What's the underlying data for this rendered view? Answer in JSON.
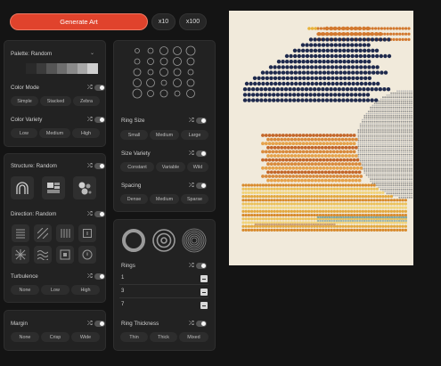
{
  "header": {
    "generate_label": "Generate Art",
    "x10_label": "x10",
    "x100_label": "x100"
  },
  "palette": {
    "label": "Palette:",
    "value": "Random",
    "swatches": [
      "#2a2a2a",
      "#3b3b3b",
      "#555555",
      "#6e6e6e",
      "#8a8a8a",
      "#a8a8a8",
      "#cfcfcf"
    ]
  },
  "color_mode": {
    "label": "Color Mode",
    "options": [
      "Simple",
      "Stacked",
      "Zebra"
    ]
  },
  "color_variety": {
    "label": "Color Variety",
    "options": [
      "Low",
      "Medium",
      "High"
    ]
  },
  "structure": {
    "label": "Structure:",
    "value": "Random"
  },
  "direction": {
    "label": "Direction:",
    "value": "Random"
  },
  "turbulence": {
    "label": "Turbulence",
    "options": [
      "None",
      "Low",
      "High"
    ]
  },
  "margin": {
    "label": "Margin",
    "options": [
      "None",
      "Crisp",
      "Wide"
    ]
  },
  "ring_size": {
    "label": "Ring Size",
    "options": [
      "Small",
      "Medium",
      "Large"
    ]
  },
  "size_variety": {
    "label": "Size Variety",
    "options": [
      "Constant",
      "Variable",
      "Wild"
    ]
  },
  "spacing": {
    "label": "Spacing",
    "options": [
      "Dense",
      "Medium",
      "Sparse"
    ]
  },
  "rings": {
    "label": "Rings",
    "items": [
      "1",
      "3",
      "7"
    ]
  },
  "ring_thickness": {
    "label": "Ring Thickness",
    "options": [
      "Thin",
      "Thick",
      "Mixed"
    ]
  },
  "colors": {
    "accent": "#e0432c",
    "panel": "#222222",
    "canvas": "#f1eadb",
    "navy": "#1f2a4d",
    "orange": "#d2782e",
    "gold": "#e8b23a",
    "gray": "#a3a3a3",
    "teal": "#7fa7a4"
  }
}
